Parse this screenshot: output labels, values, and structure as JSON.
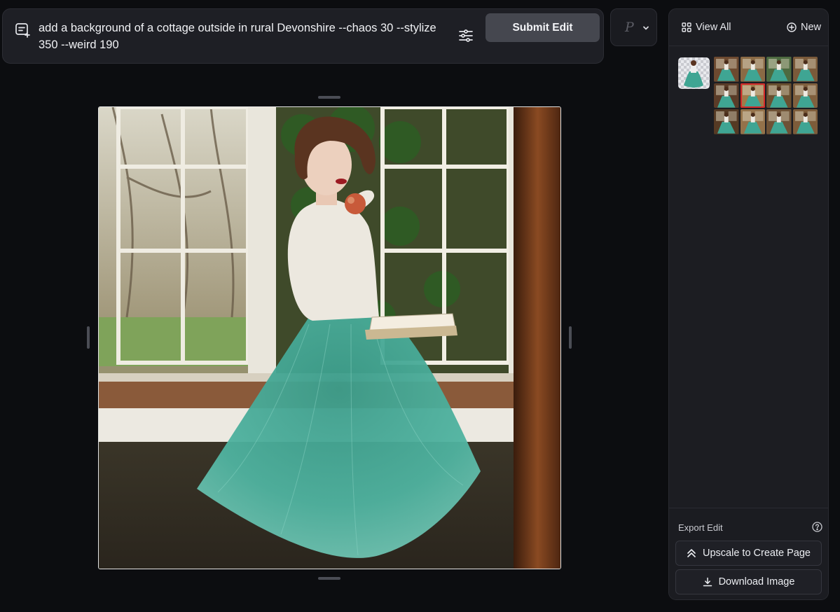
{
  "prompt": {
    "icon": "edit-frame-icon",
    "text": "add a background of a cottage outside in rural Devonshire --chaos 30 --stylize 350 --weird 190",
    "settings_icon": "sliders-icon",
    "submit_label": "Submit Edit"
  },
  "model_selector": {
    "glyph": "P",
    "chevron_icon": "chevron-down-icon"
  },
  "canvas": {
    "image_description": "edited-photo-woman-in-teal-tulle-skirt-at-cottage-window"
  },
  "panel": {
    "view_all_label": "View All",
    "view_all_icon": "grid-icon",
    "new_label": "New",
    "new_icon": "plus-circle-icon",
    "thumbnail_grid_count": 12,
    "selected_thumbnail_index": 5,
    "export_label": "Export Edit",
    "help_icon": "help-circle-icon",
    "upscale_label": "Upscale to Create Page",
    "upscale_icon": "chevrons-up-icon",
    "download_label": "Download Image",
    "download_icon": "download-icon"
  },
  "colors": {
    "background": "#0c0d10",
    "panel": "#1c1d22",
    "submit_button": "#45474f",
    "selected_outline": "#d52a2a",
    "skirt_teal": "#3fa593"
  }
}
